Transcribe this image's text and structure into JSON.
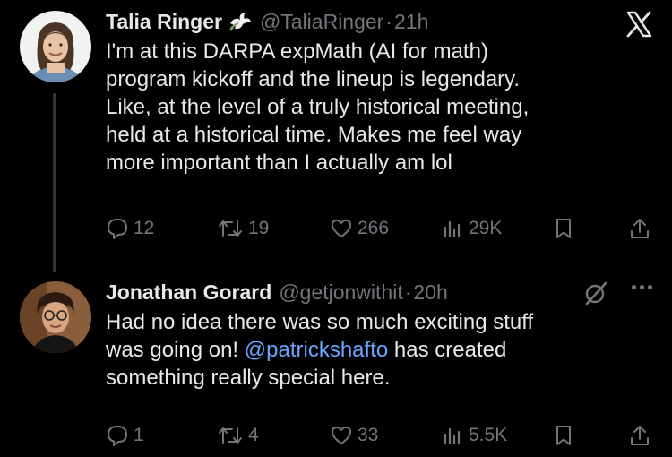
{
  "tweets": [
    {
      "display_name": "Talia Ringer",
      "badge_icon": "dove-icon",
      "handle": "@TaliaRinger",
      "separator": "·",
      "time": "21h",
      "lines": [
        "I'm at this DARPA expMath (AI for math)",
        "program kickoff and the lineup is legendary.",
        "Like, at the level of a truly historical meeting,",
        "held at a historical time. Makes me feel way",
        "more important than I actually am lol"
      ],
      "replies": "12",
      "reposts": "19",
      "likes": "266",
      "views": "29K"
    },
    {
      "display_name": "Jonathan Gorard",
      "handle": "@getjonwithit",
      "separator": "·",
      "time": "20h",
      "lines": {
        "l1": "Had no idea there was so much exciting stuff",
        "l2_before": "was going on! ",
        "l2_mention": "@patrickshafto",
        "l2_after": " has created",
        "l3": "something really special here."
      },
      "replies": "1",
      "reposts": "4",
      "likes": "33",
      "views": "5.5K"
    }
  ],
  "icons": {
    "top_right": "x-logo-icon",
    "menu": "more-options-icon",
    "grok": "grok-icon"
  },
  "colors": {
    "background": "#000000",
    "text": "#e7e9ea",
    "muted": "#71767b",
    "mention": "#6aa5ff",
    "thread_line": "#333639"
  }
}
